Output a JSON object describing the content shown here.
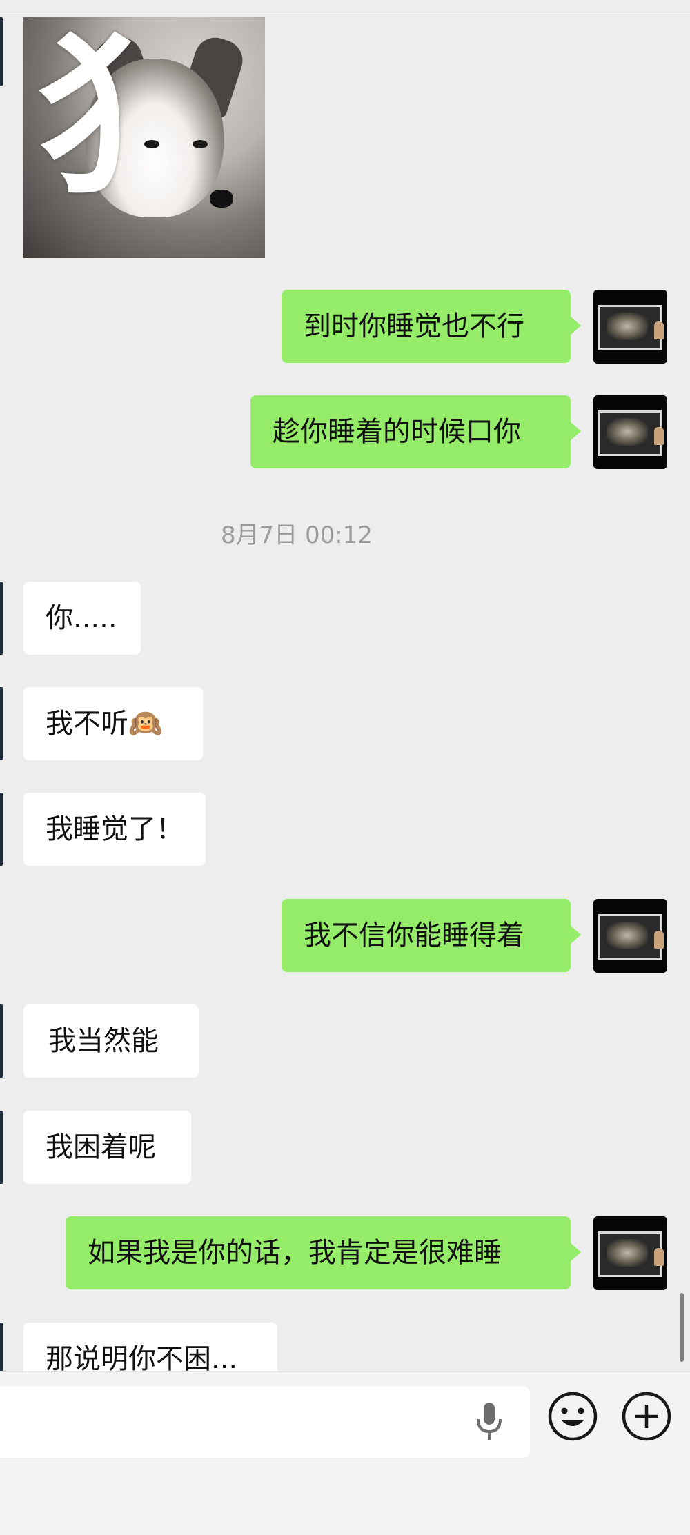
{
  "colors": {
    "my_bubble": "#95ec69",
    "their_bubble": "#ffffff",
    "background": "#ededed"
  },
  "sticker": {
    "name": "husky-sticker",
    "caption_glyph": "犭"
  },
  "timestamp": "8月7日 00:12",
  "messages": [
    {
      "sender": "me",
      "text": "到时你睡觉也不行"
    },
    {
      "sender": "me",
      "text": "趁你睡着的时候口你"
    },
    {
      "sender": "them",
      "text": "你....."
    },
    {
      "sender": "them",
      "text": "我不听🙉"
    },
    {
      "sender": "them",
      "text": "我睡觉了！"
    },
    {
      "sender": "me",
      "text": "我不信你能睡得着"
    },
    {
      "sender": "them",
      "text": " 我当然能"
    },
    {
      "sender": "them",
      "text": "我困着呢"
    },
    {
      "sender": "me",
      "text": "如果我是你的话，我肯定是很难睡"
    },
    {
      "sender": "them",
      "text": "那说明你不困..."
    }
  ],
  "input_bar": {
    "voice_icon": "microphone-icon",
    "emoji_icon": "emoji-icon",
    "more_icon": "plus-icon"
  }
}
